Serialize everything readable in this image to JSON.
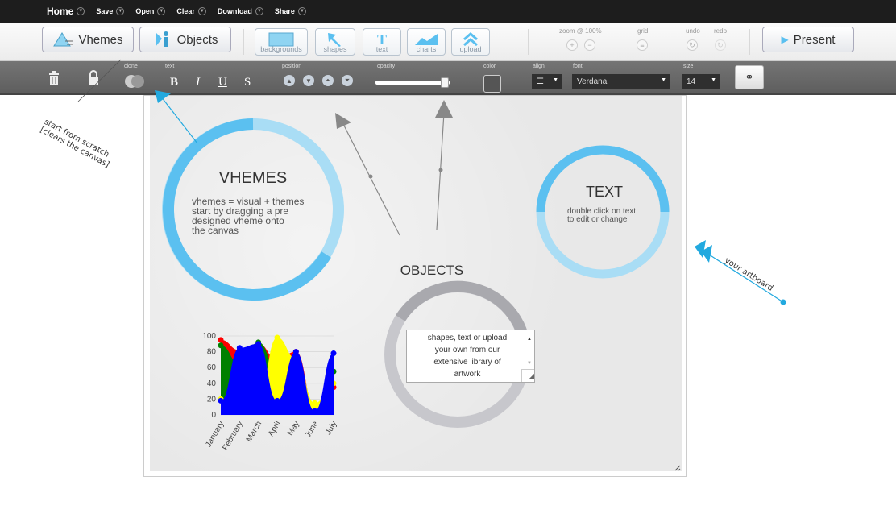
{
  "menu": {
    "items": [
      "Home",
      "Save",
      "Open",
      "Clear",
      "Download",
      "Share"
    ]
  },
  "toolbar": {
    "vhemes_label": "Vhemes",
    "objects_label": "Objects",
    "tools": [
      "backgrounds",
      "shapes",
      "text",
      "charts",
      "upload"
    ],
    "zoom_label": "zoom @ 100%",
    "grid_label": "grid",
    "undo_label": "undo",
    "redo_label": "redo",
    "present_label": "Present"
  },
  "formatbar": {
    "clone_label": "clone",
    "text_label": "text",
    "bold": "B",
    "italic": "I",
    "underline": "U",
    "strike": "S",
    "position_label": "position",
    "opacity_label": "opacity",
    "opacity_value": 0.95,
    "color_label": "color",
    "align_label": "align",
    "font_label": "font",
    "font_value": "Verdana",
    "size_label": "size",
    "size_value": "14"
  },
  "canvas": {
    "vhemes_title": "VHEMES",
    "vhemes_lines": [
      "vhemes = visual + themes",
      "start by dragging a pre",
      "designed vheme onto",
      "the canvas"
    ],
    "text_title": "TEXT",
    "text_lines": [
      "double click on text",
      "to edit or change"
    ],
    "objects_title": "OBJECTS",
    "textbox_lines": [
      "shapes, text or upload",
      "your own from our",
      "extensive library of",
      "artwork"
    ]
  },
  "annotations": {
    "start_line1": "start from scratch",
    "start_line2": "[clears the canvas]",
    "artboard": "your artboard"
  },
  "colors": {
    "ring_blue": "#5bc0f0",
    "ring_light": "#a9ddf5",
    "ring_gray": "#c7c7cc",
    "accent": "#00a2e8"
  },
  "chart_data": {
    "type": "area",
    "categories": [
      "January",
      "February",
      "March",
      "April",
      "May",
      "June",
      "July"
    ],
    "ylim": [
      0,
      100
    ],
    "yticks": [
      "100",
      "80",
      "60",
      "40",
      "20",
      "0"
    ],
    "series": [
      {
        "color": "#ff0000",
        "values": [
          95,
          82,
          90,
          70,
          80,
          12,
          35
        ]
      },
      {
        "color": "#008000",
        "values": [
          88,
          65,
          92,
          58,
          75,
          8,
          55
        ]
      },
      {
        "color": "#ffff00",
        "values": [
          20,
          35,
          25,
          98,
          72,
          15,
          40
        ]
      },
      {
        "color": "#0000ff",
        "values": [
          18,
          85,
          90,
          18,
          80,
          5,
          78
        ]
      }
    ]
  }
}
